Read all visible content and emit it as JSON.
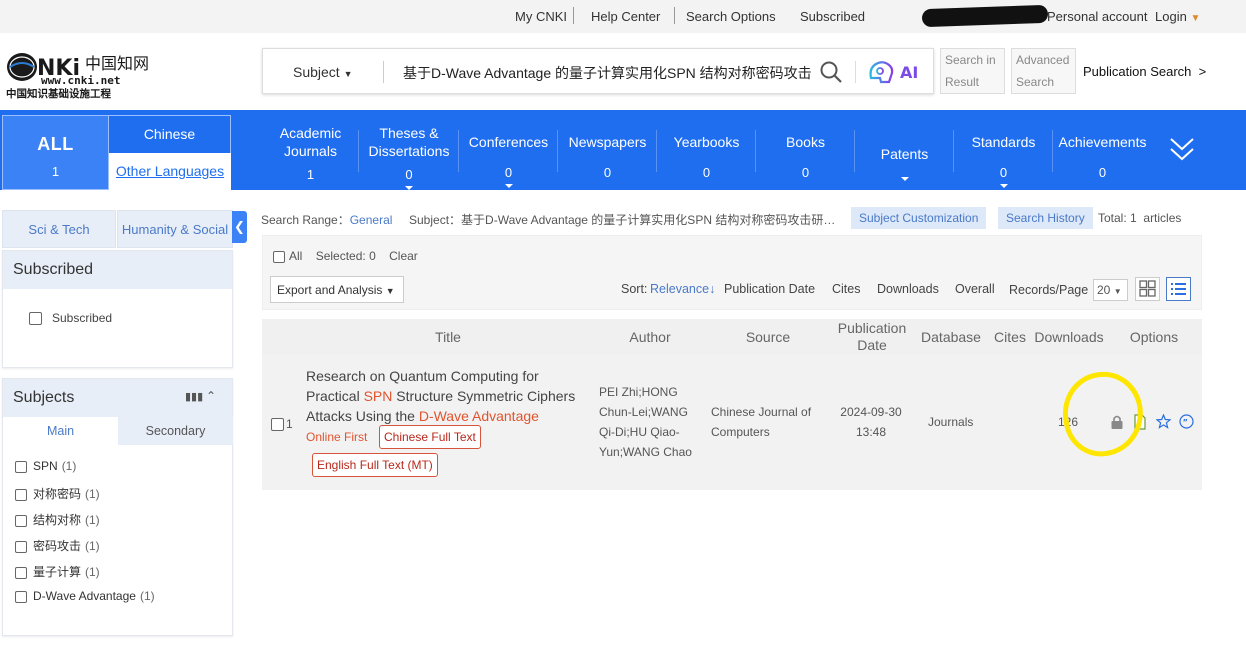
{
  "topbar": {
    "my_cnki": "My CNKI",
    "help_center": "Help Center",
    "search_options": "Search Options",
    "subscribed": "Subscribed",
    "personal_account": "Personal account",
    "login": "Login"
  },
  "logo": {
    "domain_text": "www.cnki.net",
    "cn_text": "中国知识基础设施工程"
  },
  "search": {
    "field": "Subject",
    "query": "基于D-Wave Advantage 的量子计算实用化SPN 结构对称密码攻击",
    "ai_label": "AI",
    "search_in_result_1": "Search in",
    "search_in_result_2": "Result",
    "advanced_1": "Advanced",
    "advanced_2": "Search",
    "publication_search": "Publication Search"
  },
  "nav": {
    "all_label": "ALL",
    "all_count": "1",
    "chinese": "Chinese",
    "other_languages": "Other Languages",
    "categories": [
      {
        "l1": "Academic",
        "l2": "Journals",
        "count": "1"
      },
      {
        "l1": "Theses &",
        "l2": "Dissertations",
        "count": "0"
      },
      {
        "l1": "Conferences",
        "l2": "",
        "count": "0"
      },
      {
        "l1": "Newspapers",
        "l2": "",
        "count": "0"
      },
      {
        "l1": "Yearbooks",
        "l2": "",
        "count": "0"
      },
      {
        "l1": "Books",
        "l2": "",
        "count": "0"
      },
      {
        "l1": "Patents",
        "l2": "",
        "count": ""
      },
      {
        "l1": "Standards",
        "l2": "",
        "count": "0"
      },
      {
        "l1": "Achievements",
        "l2": "",
        "count": "0"
      }
    ]
  },
  "sidebar": {
    "tab_sci": "Sci & Tech",
    "tab_hum": "Humanity & Social",
    "subscribed_header": "Subscribed",
    "subscribed_item": "Subscribed",
    "subjects_header": "Subjects",
    "tab_main": "Main",
    "tab_secondary": "Secondary",
    "facets": [
      {
        "label": "SPN",
        "count": "(1)"
      },
      {
        "label": "对称密码",
        "count": "(1)"
      },
      {
        "label": "结构对称",
        "count": "(1)"
      },
      {
        "label": "密码攻击",
        "count": "(1)"
      },
      {
        "label": "量子计算",
        "count": "(1)"
      },
      {
        "label": "D-Wave Advantage",
        "count": "(1)"
      }
    ]
  },
  "results_info": {
    "range_label": "Search Range：",
    "range_value": "General",
    "subject_label": "Subject：",
    "subject_value": "基于D-Wave Advantage 的量子计算实用化SPN 结构对称密码攻击研…",
    "subject_customization": "Subject Customization",
    "search_history": "Search History",
    "total_label": "Total:",
    "total_value": "1",
    "articles": "articles"
  },
  "toolbar": {
    "all": "All",
    "selected_label": "Selected:",
    "selected_count": "0",
    "clear": "Clear",
    "export": "Export and Analysis",
    "sort_label": "Sort:",
    "sort_relevance": "Relevance",
    "sort_pubdate": "Publication Date",
    "sort_cites": "Cites",
    "sort_downloads": "Downloads",
    "sort_overall": "Overall",
    "records_label": "Records/Page",
    "records_value": "20"
  },
  "table": {
    "headers": {
      "title": "Title",
      "author": "Author",
      "source": "Source",
      "pubdate_1": "Publication",
      "pubdate_2": "Date",
      "database": "Database",
      "cites": "Cites",
      "downloads": "Downloads",
      "options": "Options"
    },
    "row": {
      "index": "1",
      "title_a": "Research on Quantum Computing for Practical ",
      "title_hl1": "SPN",
      "title_b": " Structure Symmetric Ciphers Attacks Using the ",
      "title_hl2": "D-Wave Advantage",
      "online_first": "Online First",
      "chinese_full_text": "Chinese Full Text",
      "english_full_text": "English Full Text (MT)",
      "author": "PEI Zhi;HONG Chun-Lei;WANG Qi-Di;HU Qiao-Yun;WANG Chao",
      "source": "Chinese Journal of Computers",
      "date_1": "2024-09-30",
      "date_2": "13:48",
      "database": "Journals",
      "downloads": "126"
    }
  },
  "colors": {
    "nav_blue": "#1f6ef0",
    "highlight": "#e0542e",
    "annotation": "#ffe600"
  }
}
